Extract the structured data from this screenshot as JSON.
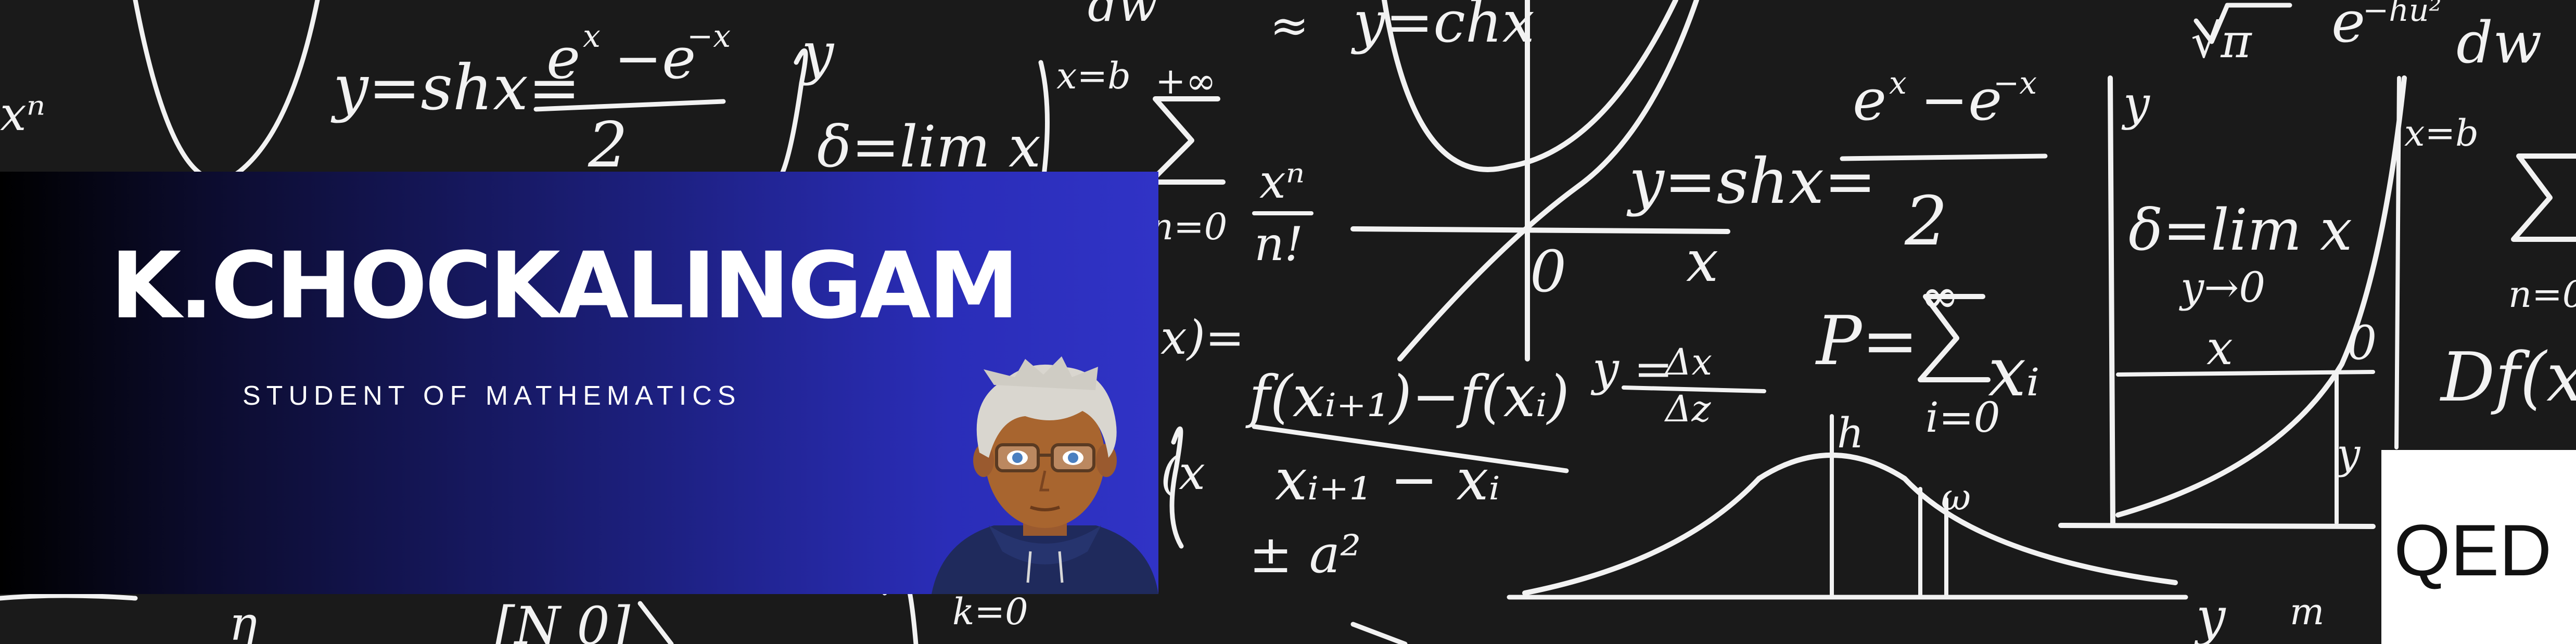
{
  "banner": {
    "name": "K.CHOCKALINGAM",
    "subtitle": "STUDENT OF MATHEMATICS",
    "corner_label": "QED"
  },
  "background": {
    "formulas": [
      "y=shx=",
      "e",
      "x",
      "−e",
      "−x",
      "2",
      "y=chx",
      "x=b",
      "+∞",
      "∑",
      "n=0",
      "xⁿ",
      "n!",
      "y",
      "x",
      "δ=lim x",
      "y→0",
      "0",
      "y = ",
      "Δx",
      "Δz",
      "P=",
      "i=0",
      "xᵢ",
      "h",
      "ω",
      "f(xᵢ₊₁)−f(xᵢ)",
      "xᵢ₊₁ − xᵢ",
      "± a²",
      "Df(x)=",
      "√π",
      "e",
      "−hu²",
      "dw"
    ]
  },
  "colors": {
    "background": "#1a1a1a",
    "chalk": "#f2f2f2",
    "panel_start": "#000000",
    "panel_end": "#3033c6",
    "title_text": "#ffffff",
    "qed_box": "#ffffff",
    "qed_text": "#111111"
  }
}
